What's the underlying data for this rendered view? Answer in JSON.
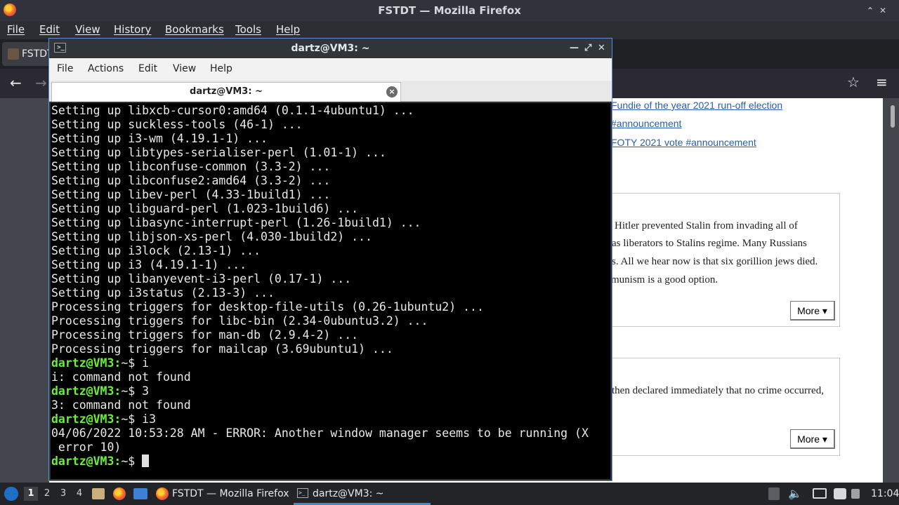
{
  "firefox": {
    "window_title": "FSTDT — Mozilla Firefox",
    "menu": [
      "File",
      "Edit",
      "View",
      "History",
      "Bookmarks",
      "Tools",
      "Help"
    ],
    "tab_title": "FSTDT",
    "page": {
      "links": [
        "Fundie of the year 2021 run-off election",
        "#announcement",
        "FOTY 2021 vote #announcement"
      ],
      "card1_lines": [
        "Hitler prevented Stalin from invading all of",
        "as liberators to Stalins regime. Many Russians",
        "s. All we hear now is that six gorillion jews died.",
        "munism is a good option."
      ],
      "card2_line": "then declared immediately that no crime occurred,",
      "more_label": "More ▾"
    }
  },
  "terminal": {
    "title": "dartz@VM3: ~",
    "menu": [
      "File",
      "Actions",
      "Edit",
      "View",
      "Help"
    ],
    "tab_title": "dartz@VM3: ~",
    "lines": [
      {
        "p": "",
        "t": "Setting up libxcb-cursor0:amd64 (0.1.1-4ubuntu1) ..."
      },
      {
        "p": "",
        "t": "Setting up suckless-tools (46-1) ..."
      },
      {
        "p": "",
        "t": "Setting up i3-wm (4.19.1-1) ..."
      },
      {
        "p": "",
        "t": "Setting up libtypes-serialiser-perl (1.01-1) ..."
      },
      {
        "p": "",
        "t": "Setting up libconfuse-common (3.3-2) ..."
      },
      {
        "p": "",
        "t": "Setting up libconfuse2:amd64 (3.3-2) ..."
      },
      {
        "p": "",
        "t": "Setting up libev-perl (4.33-1build1) ..."
      },
      {
        "p": "",
        "t": "Setting up libguard-perl (1.023-1build6) ..."
      },
      {
        "p": "",
        "t": "Setting up libasync-interrupt-perl (1.26-1build1) ..."
      },
      {
        "p": "",
        "t": "Setting up libjson-xs-perl (4.030-1build2) ..."
      },
      {
        "p": "",
        "t": "Setting up i3lock (2.13-1) ..."
      },
      {
        "p": "",
        "t": "Setting up i3 (4.19.1-1) ..."
      },
      {
        "p": "",
        "t": "Setting up libanyevent-i3-perl (0.17-1) ..."
      },
      {
        "p": "",
        "t": "Setting up i3status (2.13-3) ..."
      },
      {
        "p": "",
        "t": "Processing triggers for desktop-file-utils (0.26-1ubuntu2) ..."
      },
      {
        "p": "",
        "t": "Processing triggers for libc-bin (2.34-0ubuntu3.2) ..."
      },
      {
        "p": "",
        "t": "Processing triggers for man-db (2.9.4-2) ..."
      },
      {
        "p": "",
        "t": "Processing triggers for mailcap (3.69ubuntu1) ..."
      },
      {
        "p": "dartz@VM3:",
        "t": "~$ i"
      },
      {
        "p": "",
        "t": "i: command not found"
      },
      {
        "p": "dartz@VM3:",
        "t": "~$ 3"
      },
      {
        "p": "",
        "t": "3: command not found"
      },
      {
        "p": "dartz@VM3:",
        "t": "~$ i3"
      },
      {
        "p": "",
        "t": "04/06/2022 10:53:28 AM - ERROR: Another window manager seems to be running (X"
      },
      {
        "p": "",
        "t": " error 10)"
      }
    ],
    "final_prompt": "dartz@VM3:",
    "final_text": "~$ "
  },
  "taskbar": {
    "workspaces": [
      "1",
      "2",
      "3",
      "4"
    ],
    "tasks": [
      "FSTDT — Mozilla Firefox",
      "dartz@VM3: ~"
    ],
    "clock": "11:04"
  },
  "colors": {
    "prompt": "#6aef3a",
    "accent": "#3d8bd6",
    "link": "#2a5db0"
  }
}
